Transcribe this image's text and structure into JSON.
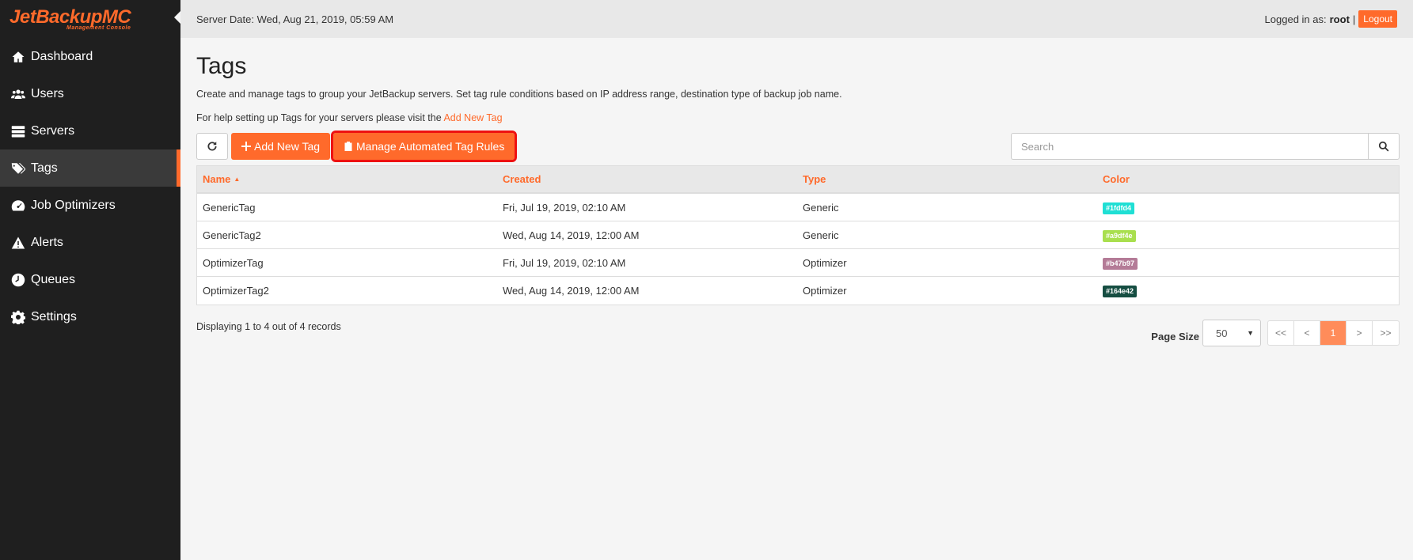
{
  "app": {
    "logo_main": "JetBackupMC",
    "logo_sub": "Management Console"
  },
  "sidebar": {
    "items": [
      {
        "label": "Dashboard",
        "icon": "home-icon",
        "active": false
      },
      {
        "label": "Users",
        "icon": "users-icon",
        "active": false
      },
      {
        "label": "Servers",
        "icon": "servers-icon",
        "active": false
      },
      {
        "label": "Tags",
        "icon": "tags-icon",
        "active": true
      },
      {
        "label": "Job Optimizers",
        "icon": "gauge-icon",
        "active": false
      },
      {
        "label": "Alerts",
        "icon": "warning-icon",
        "active": false
      },
      {
        "label": "Queues",
        "icon": "clock-icon",
        "active": false
      },
      {
        "label": "Settings",
        "icon": "gear-icon",
        "active": false
      }
    ]
  },
  "topbar": {
    "server_date": "Server Date: Wed, Aug 21, 2019, 05:59 AM",
    "logged_in_prefix": "Logged in as:",
    "username": "root",
    "separator": "|",
    "logout_label": "Logout"
  },
  "page": {
    "title": "Tags",
    "description": "Create and manage tags to group your JetBackup servers. Set tag rule conditions based on IP address range, destination type of backup job name.",
    "help_prefix": "For help setting up Tags for your servers please visit the",
    "help_link": "Add New Tag"
  },
  "toolbar": {
    "add_label": "Add New Tag",
    "manage_label": "Manage Automated Tag Rules",
    "search_placeholder": "Search"
  },
  "table": {
    "columns": [
      "Name",
      "Created",
      "Type",
      "Color"
    ],
    "sort_indicator": "▲",
    "rows": [
      {
        "name": "GenericTag",
        "created": "Fri, Jul 19, 2019, 02:10 AM",
        "type": "Generic",
        "color": "#1fdfd4"
      },
      {
        "name": "GenericTag2",
        "created": "Wed, Aug 14, 2019, 12:00 AM",
        "type": "Generic",
        "color": "#a9df4e"
      },
      {
        "name": "OptimizerTag",
        "created": "Fri, Jul 19, 2019, 02:10 AM",
        "type": "Optimizer",
        "color": "#b47b97"
      },
      {
        "name": "OptimizerTag2",
        "created": "Wed, Aug 14, 2019, 12:00 AM",
        "type": "Optimizer",
        "color": "#164e42"
      }
    ]
  },
  "footer": {
    "records_text": "Displaying 1 to 4 out of 4 records",
    "page_size_label": "Page Size",
    "page_size_value": "50",
    "pages": [
      "<<",
      "<",
      "1",
      ">",
      ">>"
    ],
    "current_page": "1"
  },
  "colors": {
    "accent": "#ff6a2b",
    "sidebar_bg": "#1f1f1f",
    "highlight_outline": "#e11111"
  }
}
